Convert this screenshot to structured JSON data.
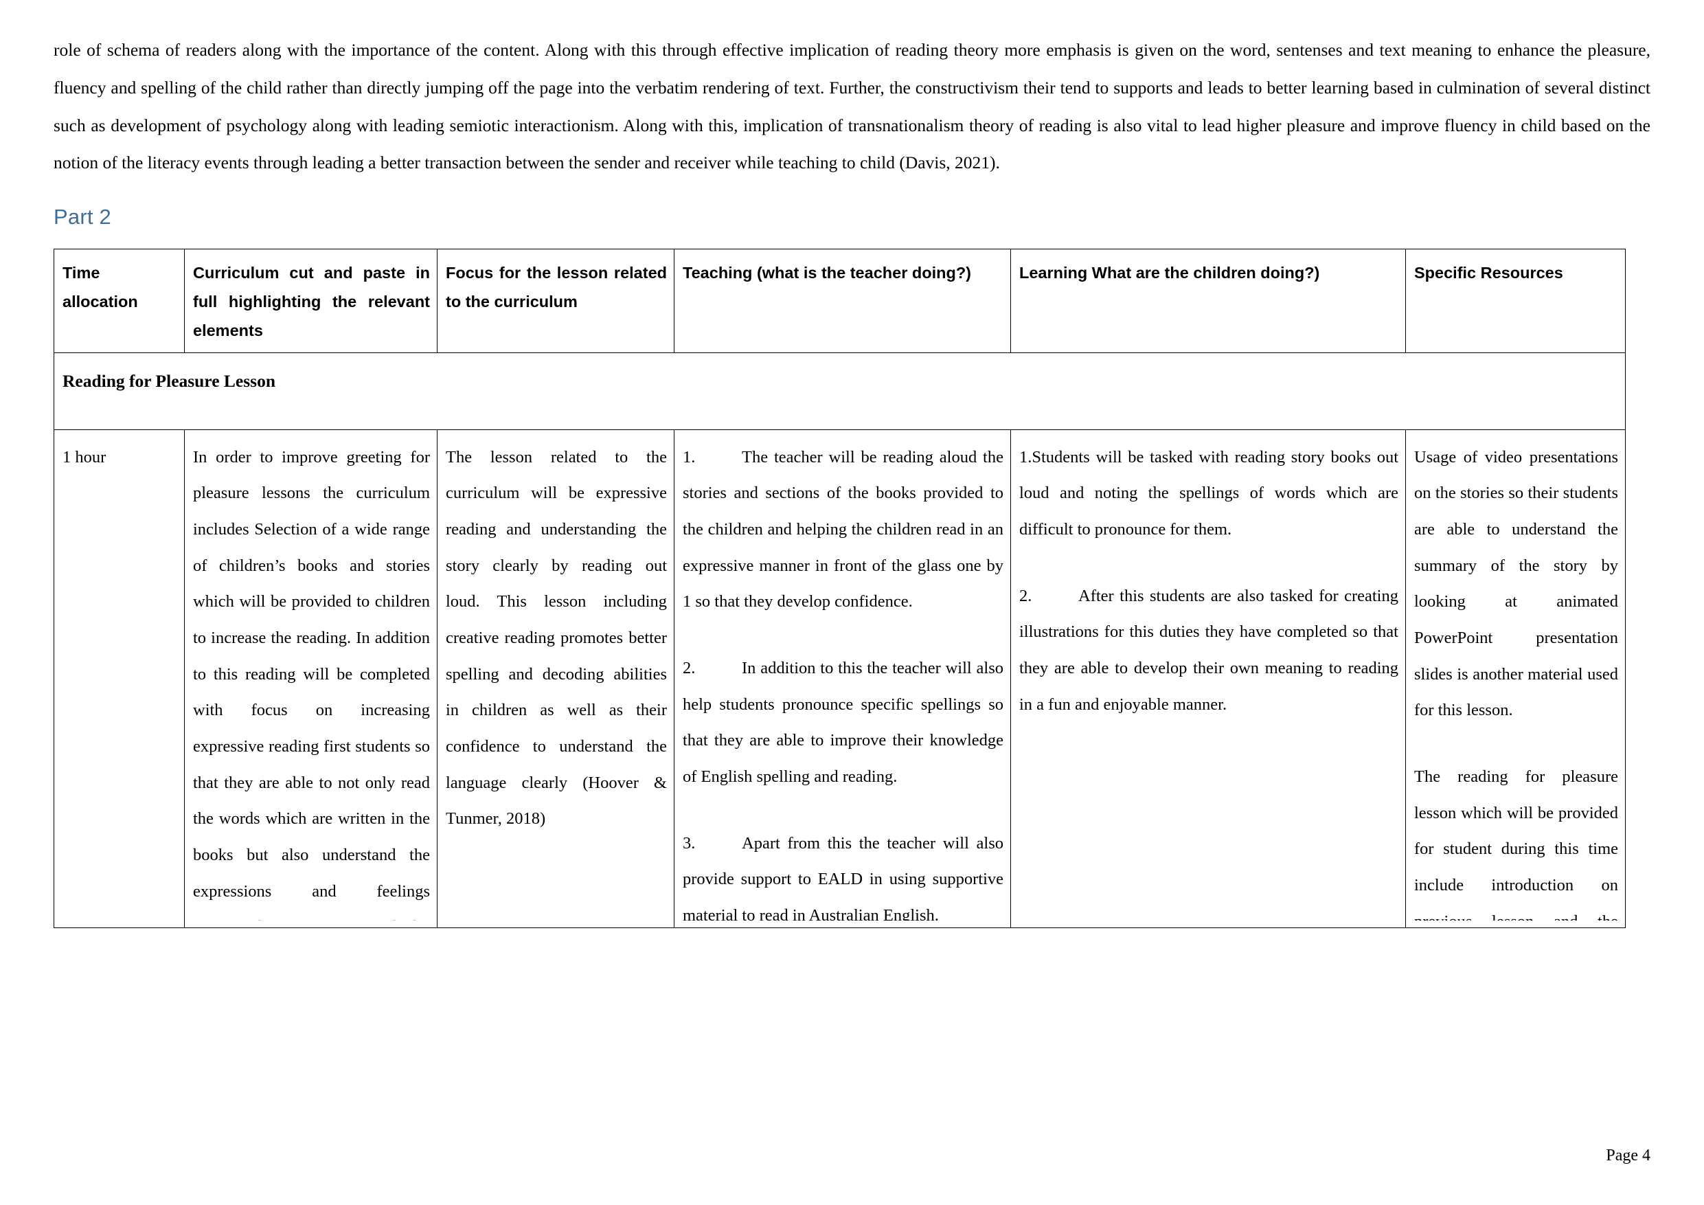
{
  "document": {
    "intro_paragraph": "role of schema of readers along with the importance of the content. Along with this through effective implication of reading theory more emphasis is given on the word, sentenses and text meaning to enhance the pleasure, fluency and spelling of the child rather than directly jumping off the page into the verbatim rendering of text. Further, the constructivism their tend to supports and leads to better learning based in culmination of several distinct such as development of psychology along with leading semiotic interactionism. Along with this, implication of transnationalism theory of reading is also vital to lead higher pleasure and improve fluency in child based on the notion of the literacy events through leading a better transaction between the sender and receiver while teaching to child (Davis, 2021).",
    "section_heading": "Part 2",
    "heading_color": "#3E6D9C",
    "footer": "Page 4"
  },
  "table": {
    "headers": [
      "Time allocation",
      "Curriculum cut and paste in full highlighting the relevant elements",
      "Focus for the lesson related to the curriculum",
      "Teaching (what is the teacher doing?)",
      "Learning What are the children doing?)",
      "Specific Resources"
    ],
    "section_row_label": "Reading for Pleasure Lesson",
    "rows": [
      {
        "time_allocation": "1 hour",
        "curriculum": "In order to improve greeting for pleasure lessons the curriculum includes Selection of a wide range of children’s books and stories which will be provided to children to increase the reading. In addition to this reading will be completed with focus on increasing expressive reading first students so that they are able to not only read the words which are written in the books but also understand the expressions and feelings associated with the word by connecting grammatical elements of the sentences such speech and punctuation marks. Expressive reading increases student confidence (Horowitz-Kraus & Hutton, 2018). The story books which will be utilized in this case include interesting story books such as the adventures of Harry Stevenson,  where the sidewalk",
        "focus": "The lesson related to the curriculum will be expressive reading and understanding the story clearly by reading out loud. This lesson including creative reading promotes better spelling and decoding abilities in children as well as their confidence to understand the language clearly (Hoover & Tunmer, 2018)",
        "teaching": [
          {
            "number": "1.",
            "text": "The teacher will be reading aloud the stories and sections of the books provided to the children and helping the children read in an expressive manner in front of the glass one by 1 so that they develop confidence."
          },
          {
            "number": "2.",
            "text": "In addition to this the teacher will also help students pronounce specific spellings so that they are able to improve their knowledge of English spelling and reading."
          },
          {
            "number": "3.",
            "text": "Apart from this the teacher will also provide support to EALD in using supportive material to read in Australian English."
          }
        ],
        "learning": [
          {
            "number": "1.",
            "text": "Students will be tasked with reading story books out loud and noting the spellings of words which are difficult to pronounce for them."
          },
          {
            "number": "2.",
            "text": "After this students are also tasked for creating illustrations for this duties they have completed so that they are able to develop their own meaning to reading in a fun and enjoyable manner."
          }
        ],
        "resources": [
          "Usage of video presentations on the stories so their students are able to understand the summary of the story by looking at animated PowerPoint presentation slides is another material used for this lesson.",
          "The reading for pleasure lesson which will be provided for student during this time include introduction on previous lesson and the progress students made last time."
        ]
      }
    ]
  }
}
